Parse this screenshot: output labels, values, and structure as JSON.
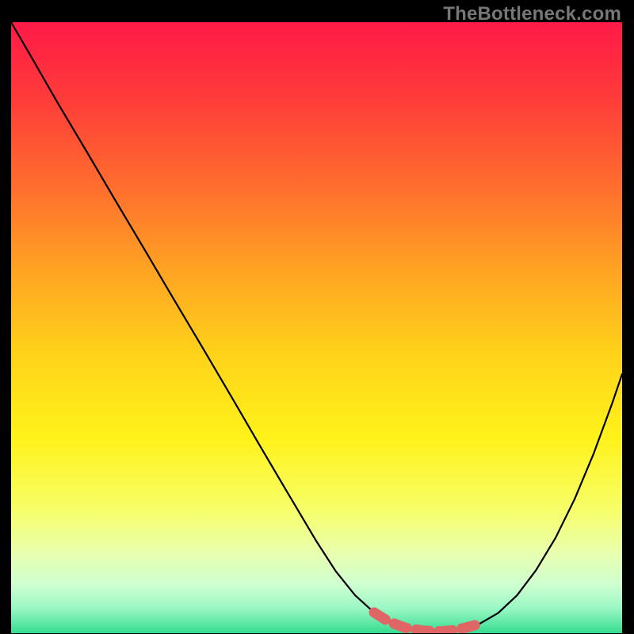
{
  "watermark": "TheBottleneck.com",
  "colors": {
    "gradient_stops": [
      {
        "offset": 0.0,
        "color": "#ff1a48"
      },
      {
        "offset": 0.12,
        "color": "#ff3a3a"
      },
      {
        "offset": 0.26,
        "color": "#ff6a2f"
      },
      {
        "offset": 0.4,
        "color": "#ffa123"
      },
      {
        "offset": 0.54,
        "color": "#ffd21a"
      },
      {
        "offset": 0.68,
        "color": "#fff21a"
      },
      {
        "offset": 0.8,
        "color": "#f7ff6a"
      },
      {
        "offset": 0.87,
        "color": "#e8ffb0"
      },
      {
        "offset": 0.92,
        "color": "#cfffd0"
      },
      {
        "offset": 0.96,
        "color": "#99f7c4"
      },
      {
        "offset": 1.0,
        "color": "#35dc90"
      }
    ],
    "curve_stroke": "#000000",
    "highlight_stroke": "#e06666",
    "frame_bg": "#000000"
  },
  "chart_data": {
    "type": "line",
    "title": "",
    "xlabel": "",
    "ylabel": "",
    "xlim": [
      0,
      100
    ],
    "ylim": [
      0,
      100
    ],
    "series": [
      {
        "name": "bottleneck-curve",
        "x": [
          0.0,
          3.2,
          7.8,
          12.5,
          17.2,
          21.9,
          26.6,
          31.3,
          36.0,
          40.6,
          45.3,
          50.0,
          53.1,
          56.3,
          59.4,
          62.5,
          65.0,
          67.5,
          70.3,
          73.4,
          76.6,
          79.7,
          82.8,
          85.9,
          89.1,
          92.2,
          95.3,
          98.4,
          100.0
        ],
        "y": [
          100.0,
          94.5,
          86.5,
          78.6,
          70.6,
          62.7,
          54.7,
          46.8,
          38.8,
          30.9,
          22.9,
          15.0,
          10.2,
          6.2,
          3.4,
          1.6,
          0.7,
          0.4,
          0.3,
          0.6,
          1.5,
          3.3,
          6.2,
          10.3,
          15.6,
          21.9,
          29.3,
          37.7,
          42.4
        ]
      }
    ],
    "highlight": {
      "name": "optimal-band",
      "x": [
        59.4,
        61.8,
        64.5,
        67.5,
        70.3,
        72.6,
        74.8,
        76.6
      ],
      "y": [
        3.4,
        1.9,
        0.9,
        0.4,
        0.3,
        0.5,
        1.0,
        1.5
      ]
    }
  }
}
